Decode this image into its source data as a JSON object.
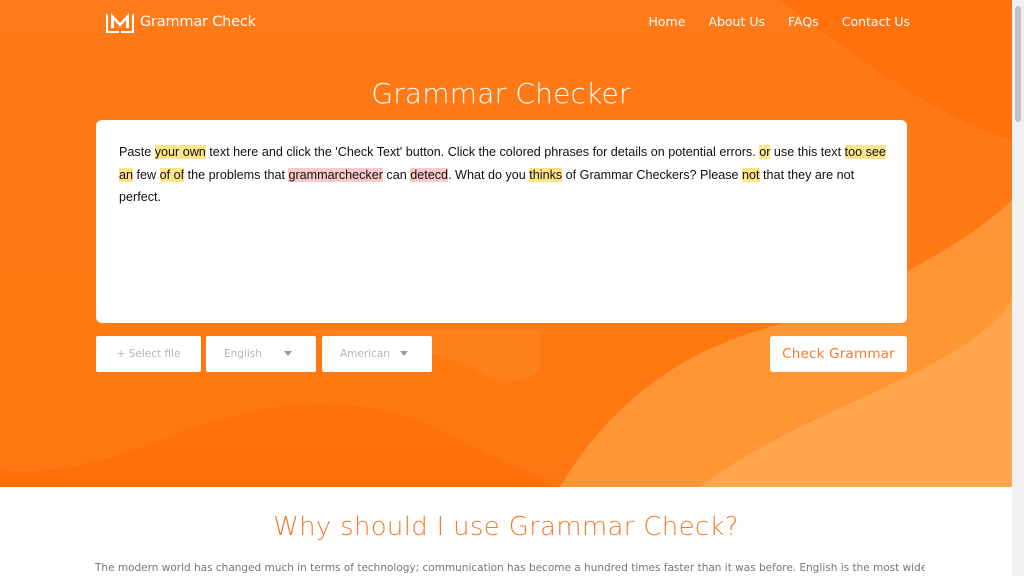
{
  "nav": {
    "logo_text": "Grammar Check",
    "items": [
      {
        "label": "Home"
      },
      {
        "label": "About Us"
      },
      {
        "label": "FAQs"
      },
      {
        "label": "Contact Us"
      }
    ]
  },
  "hero": {
    "title": "Grammar Checker"
  },
  "editor": {
    "segments": [
      {
        "t": "Paste ",
        "h": ""
      },
      {
        "t": "your own",
        "h": "y"
      },
      {
        "t": " text here and click the 'Check Text' button. Click the colored phrases for details on potential errors. ",
        "h": ""
      },
      {
        "t": "or",
        "h": "y"
      },
      {
        "t": " use this text ",
        "h": ""
      },
      {
        "t": "too see",
        "h": "y"
      },
      {
        "t": " ",
        "h": ""
      },
      {
        "t": "an",
        "h": "y"
      },
      {
        "t": " few ",
        "h": ""
      },
      {
        "t": "of of",
        "h": "y"
      },
      {
        "t": " the problems that ",
        "h": ""
      },
      {
        "t": "grammarchecker",
        "h": "r"
      },
      {
        "t": " can ",
        "h": ""
      },
      {
        "t": "detecd",
        "h": "r"
      },
      {
        "t": ". What do you ",
        "h": ""
      },
      {
        "t": "thinks",
        "h": "y"
      },
      {
        "t": " of Grammar Checkers? Please ",
        "h": ""
      },
      {
        "t": "not",
        "h": "y"
      },
      {
        "t": " that they are not perfect.",
        "h": ""
      }
    ]
  },
  "controls": {
    "file_label": "+ Select file",
    "language": "English",
    "dialect": "American",
    "check_label": "Check Grammar"
  },
  "why": {
    "heading": "Why should I use Grammar Check?",
    "paragraph": "The modern world has changed much in terms of technology; communication has become a hundred times faster than it was before. English is the most widely"
  },
  "colors": {
    "brand": "#ff7a18",
    "highlight_warning": "#ffe48a",
    "highlight_error": "#f8caca",
    "accent_text": "#f47b2e"
  }
}
